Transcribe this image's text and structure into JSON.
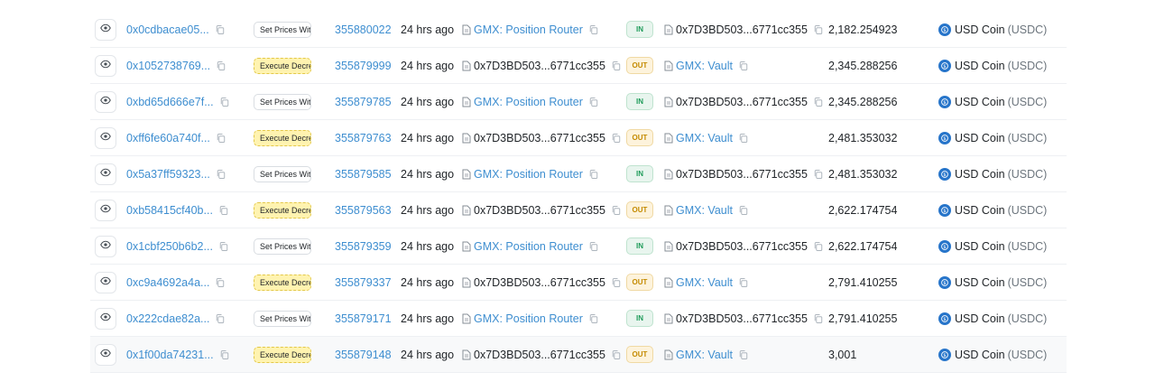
{
  "colors": {
    "link": "#3e8ed0",
    "in_badge": "#1f9c5a",
    "out_badge": "#c48a00",
    "method_highlight": "#fff3b0",
    "usdc": "#2775ca"
  },
  "icons": [
    "eye-icon",
    "copy-icon",
    "document-icon",
    "usdc-icon"
  ],
  "rows": [
    {
      "tx": "0x0cdbacae05...",
      "method": "Set Prices Wit...",
      "method_type": "set",
      "block": "355880022",
      "age": "24 hrs ago",
      "from": "GMX: Position Router",
      "from_is_link": true,
      "direction": "IN",
      "to": "0x7D3BD503...6771cc355",
      "to_is_link": false,
      "amount": "2,182.254923",
      "token": "USD Coin",
      "token_symbol": "(USDC)"
    },
    {
      "tx": "0x1052738769...",
      "method": "Execute Decre...",
      "method_type": "exec",
      "block": "355879999",
      "age": "24 hrs ago",
      "from": "0x7D3BD503...6771cc355",
      "from_is_link": false,
      "direction": "OUT",
      "to": "GMX: Vault",
      "to_is_link": true,
      "amount": "2,345.288256",
      "token": "USD Coin",
      "token_symbol": "(USDC)"
    },
    {
      "tx": "0xbd65d666e7f...",
      "method": "Set Prices Wit...",
      "method_type": "set",
      "block": "355879785",
      "age": "24 hrs ago",
      "from": "GMX: Position Router",
      "from_is_link": true,
      "direction": "IN",
      "to": "0x7D3BD503...6771cc355",
      "to_is_link": false,
      "amount": "2,345.288256",
      "token": "USD Coin",
      "token_symbol": "(USDC)"
    },
    {
      "tx": "0xff6fe60a740f...",
      "method": "Execute Decre...",
      "method_type": "exec",
      "block": "355879763",
      "age": "24 hrs ago",
      "from": "0x7D3BD503...6771cc355",
      "from_is_link": false,
      "direction": "OUT",
      "to": "GMX: Vault",
      "to_is_link": true,
      "amount": "2,481.353032",
      "token": "USD Coin",
      "token_symbol": "(USDC)"
    },
    {
      "tx": "0x5a37ff59323...",
      "method": "Set Prices Wit...",
      "method_type": "set",
      "block": "355879585",
      "age": "24 hrs ago",
      "from": "GMX: Position Router",
      "from_is_link": true,
      "direction": "IN",
      "to": "0x7D3BD503...6771cc355",
      "to_is_link": false,
      "amount": "2,481.353032",
      "token": "USD Coin",
      "token_symbol": "(USDC)"
    },
    {
      "tx": "0xb58415cf40b...",
      "method": "Execute Decre...",
      "method_type": "exec",
      "block": "355879563",
      "age": "24 hrs ago",
      "from": "0x7D3BD503...6771cc355",
      "from_is_link": false,
      "direction": "OUT",
      "to": "GMX: Vault",
      "to_is_link": true,
      "amount": "2,622.174754",
      "token": "USD Coin",
      "token_symbol": "(USDC)"
    },
    {
      "tx": "0x1cbf250b6b2...",
      "method": "Set Prices Wit...",
      "method_type": "set",
      "block": "355879359",
      "age": "24 hrs ago",
      "from": "GMX: Position Router",
      "from_is_link": true,
      "direction": "IN",
      "to": "0x7D3BD503...6771cc355",
      "to_is_link": false,
      "amount": "2,622.174754",
      "token": "USD Coin",
      "token_symbol": "(USDC)"
    },
    {
      "tx": "0xc9a4692a4a...",
      "method": "Execute Decre...",
      "method_type": "exec",
      "block": "355879337",
      "age": "24 hrs ago",
      "from": "0x7D3BD503...6771cc355",
      "from_is_link": false,
      "direction": "OUT",
      "to": "GMX: Vault",
      "to_is_link": true,
      "amount": "2,791.410255",
      "token": "USD Coin",
      "token_symbol": "(USDC)"
    },
    {
      "tx": "0x222cdae82a...",
      "method": "Set Prices Wit...",
      "method_type": "set",
      "block": "355879171",
      "age": "24 hrs ago",
      "from": "GMX: Position Router",
      "from_is_link": true,
      "direction": "IN",
      "to": "0x7D3BD503...6771cc355",
      "to_is_link": false,
      "amount": "2,791.410255",
      "token": "USD Coin",
      "token_symbol": "(USDC)"
    },
    {
      "tx": "0x1f00da74231...",
      "method": "Execute Decre...",
      "method_type": "exec",
      "block": "355879148",
      "age": "24 hrs ago",
      "from": "0x7D3BD503...6771cc355",
      "from_is_link": false,
      "direction": "OUT",
      "to": "GMX: Vault",
      "to_is_link": true,
      "amount": "3,001",
      "token": "USD Coin",
      "token_symbol": "(USDC)"
    }
  ]
}
